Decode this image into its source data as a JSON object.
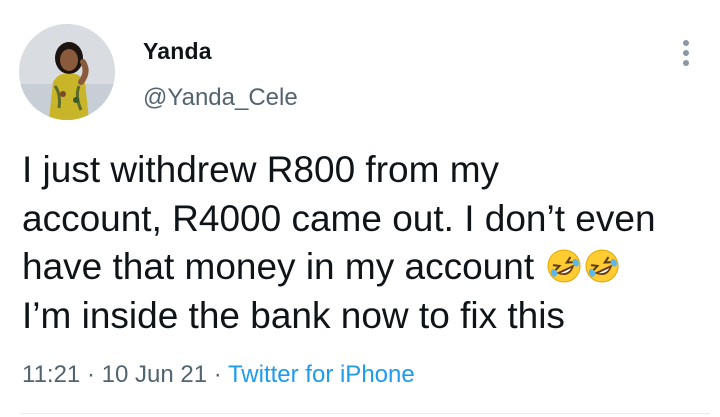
{
  "tweet": {
    "author": {
      "display_name": "Yanda",
      "handle": "@Yanda_Cele"
    },
    "text_lines": [
      "I just withdrew R800 from my",
      "account, R4000 came out. I don’t even",
      "have that money in my account",
      "I’m inside the bank now to fix this"
    ],
    "emoji": [
      "rolling-on-floor-laughing",
      "rolling-on-floor-laughing"
    ],
    "time": "11:21",
    "separator": "·",
    "date": "10 Jun 21",
    "source": "Twitter for iPhone"
  },
  "colors": {
    "text": "#0f1419",
    "secondary": "#536471",
    "link": "#1d9bf0",
    "divider": "#e6ecf0"
  },
  "icons": {
    "more": "more-vertical-icon"
  }
}
